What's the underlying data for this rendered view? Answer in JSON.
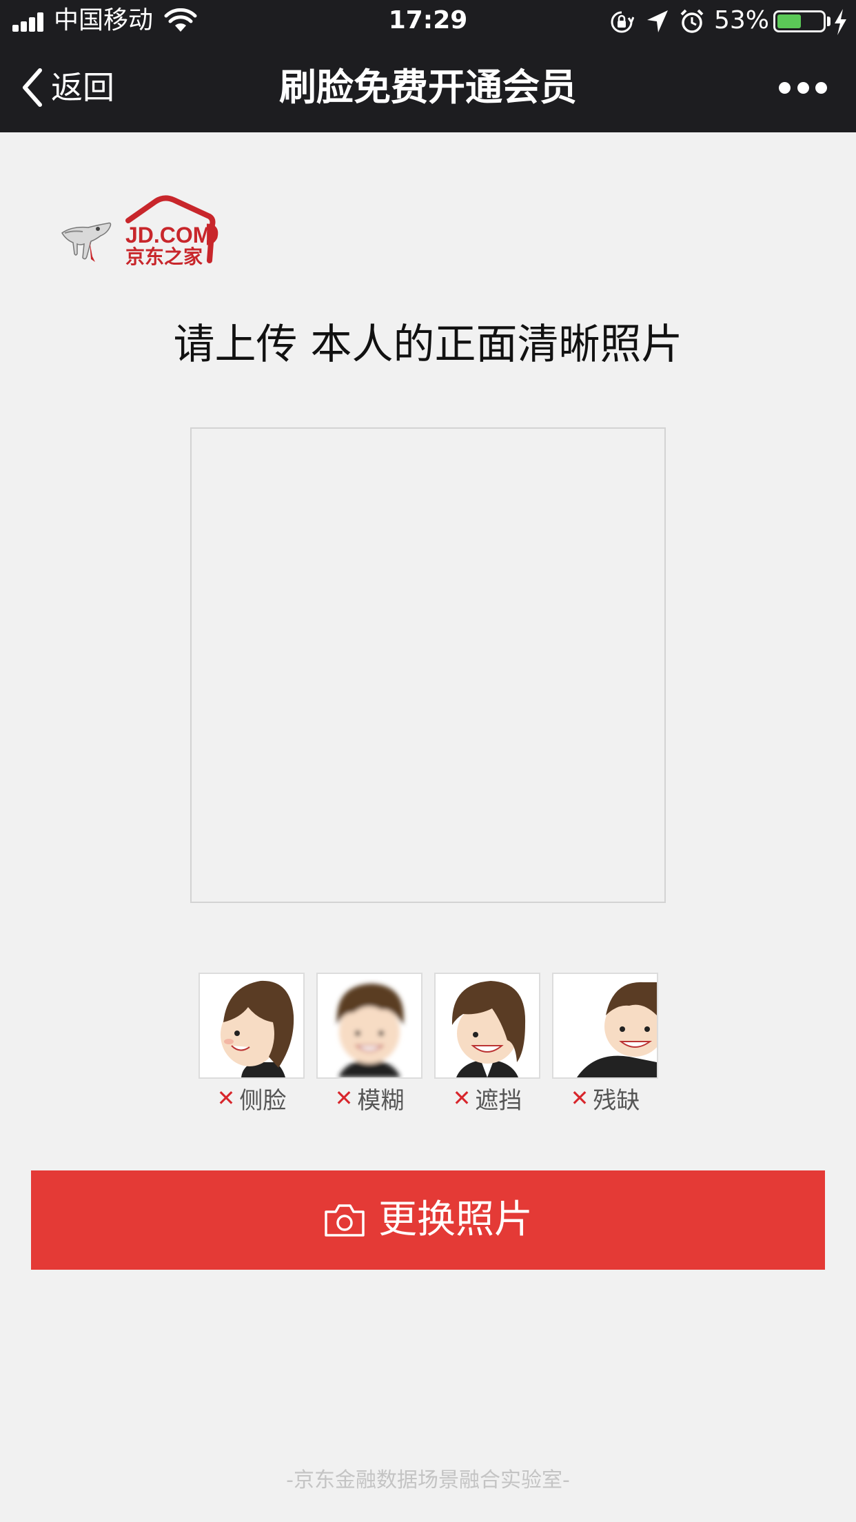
{
  "status_bar": {
    "carrier": "中国移动",
    "time": "17:29",
    "battery_percent": "53%",
    "battery_level": 0.53,
    "icons": [
      "signal-icon",
      "wifi-icon",
      "orientation-lock-icon",
      "location-icon",
      "alarm-icon",
      "battery-icon",
      "charging-icon"
    ]
  },
  "nav": {
    "back_label": "返回",
    "title": "刷脸免费开通会员",
    "more_icon": "more-dots-icon"
  },
  "logo": {
    "text_en": "JD.COM",
    "text_cn": "京东之家",
    "brand_color": "#c8262b"
  },
  "main": {
    "heading": "请上传 本人的正面清晰照片",
    "examples": [
      {
        "label": "侧脸",
        "mark": "✕"
      },
      {
        "label": "模糊",
        "mark": "✕"
      },
      {
        "label": "遮挡",
        "mark": "✕"
      },
      {
        "label": "残缺",
        "mark": "✕"
      }
    ],
    "change_photo_label": "更换照片",
    "accent_color": "#e43a36"
  },
  "footer": {
    "text": "-京东金融数据场景融合实验室-"
  }
}
